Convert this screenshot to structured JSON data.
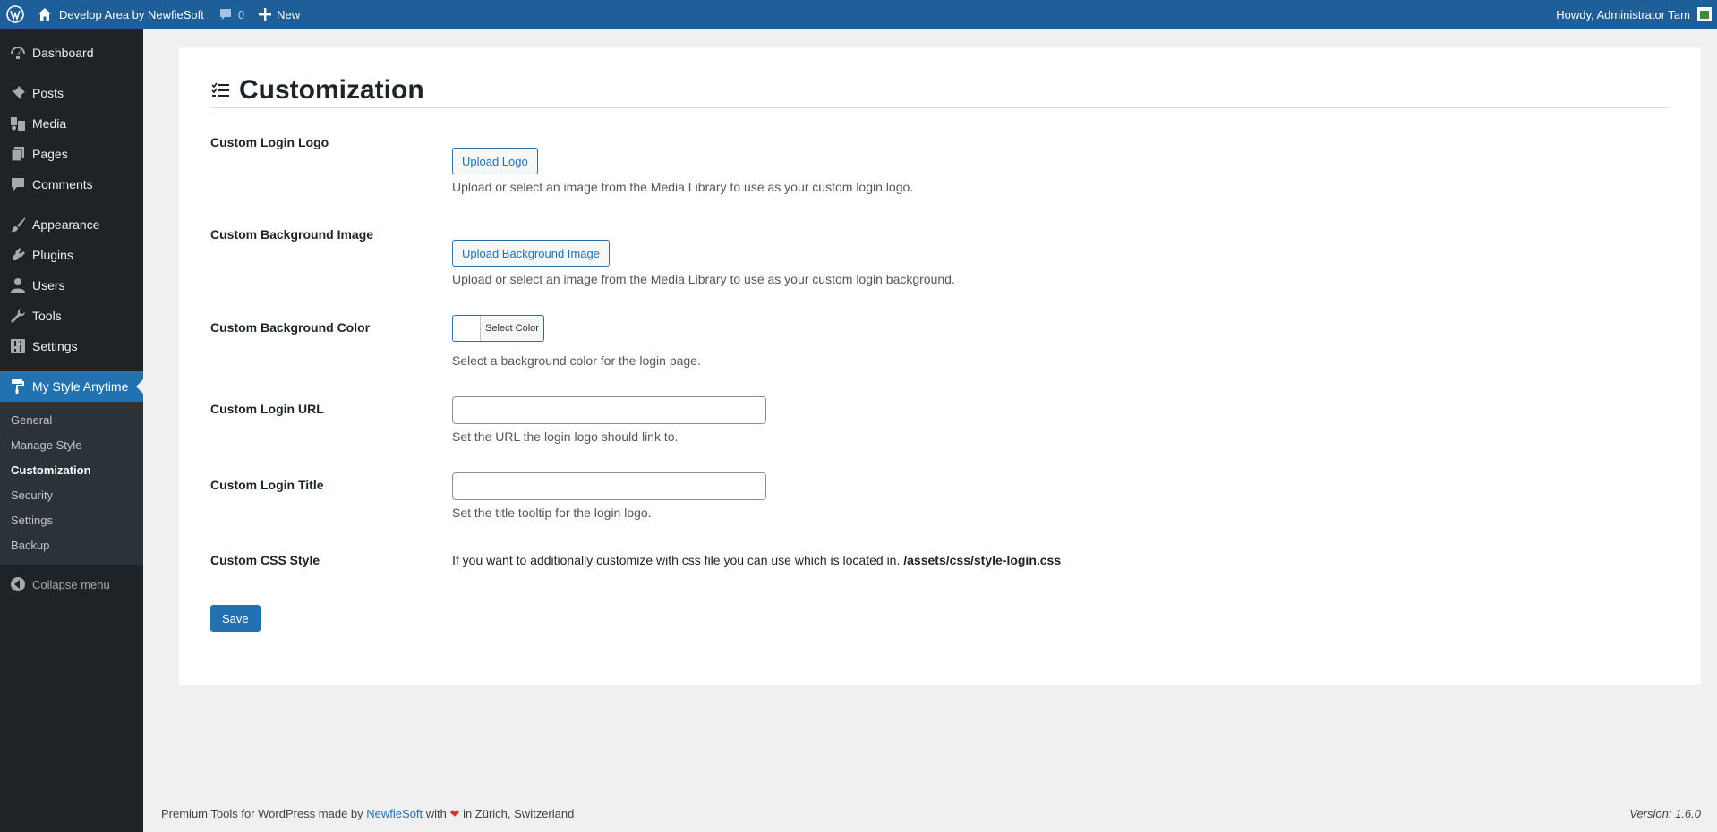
{
  "admin_bar": {
    "site_name": "Develop Area by NewfieSoft",
    "comments_count": "0",
    "new_label": "New",
    "greeting": "Howdy, Administrator Tam"
  },
  "sidebar": {
    "items": [
      {
        "label": "Dashboard",
        "icon": "dashboard-icon"
      },
      {
        "label": "Posts",
        "icon": "pin-icon"
      },
      {
        "label": "Media",
        "icon": "media-icon"
      },
      {
        "label": "Pages",
        "icon": "pages-icon"
      },
      {
        "label": "Comments",
        "icon": "comment-icon"
      },
      {
        "label": "Appearance",
        "icon": "brush-icon"
      },
      {
        "label": "Plugins",
        "icon": "plug-icon"
      },
      {
        "label": "Users",
        "icon": "user-icon"
      },
      {
        "label": "Tools",
        "icon": "wrench-icon"
      },
      {
        "label": "Settings",
        "icon": "settings-icon"
      },
      {
        "label": "My Style Anytime",
        "icon": "paint-roller-icon"
      }
    ],
    "submenu": [
      "General",
      "Manage Style",
      "Customization",
      "Security",
      "Settings",
      "Backup"
    ],
    "collapse_label": "Collapse menu"
  },
  "page": {
    "title": "Customization",
    "logo": {
      "label": "Custom Login Logo",
      "button": "Upload Logo",
      "description": "Upload or select an image from the Media Library to use as your custom login logo."
    },
    "background_image": {
      "label": "Custom Background Image",
      "button": "Upload Background Image",
      "description": "Upload or select an image from the Media Library to use as your custom login background."
    },
    "background_color": {
      "label": "Custom Background Color",
      "button": "Select Color",
      "description": "Select a background color for the login page."
    },
    "login_url": {
      "label": "Custom Login URL",
      "value": "",
      "description": "Set the URL the login logo should link to."
    },
    "login_title": {
      "label": "Custom Login Title",
      "value": "",
      "description": "Set the title tooltip for the login logo."
    },
    "css_style": {
      "label": "Custom CSS Style",
      "text": "If you want to additionally customize with css file you can use which is located in.",
      "path": "/assets/css/style-login.css"
    },
    "save_label": "Save"
  },
  "footer": {
    "prefix": "Premium Tools for WordPress made by",
    "link": "NewfieSoft",
    "with": "with",
    "suffix": "in Zürich, Switzerland",
    "version": "Version: 1.6.0"
  },
  "colors": {
    "admin_bar": "#1e5e99",
    "sidebar": "#1d2327",
    "accent": "#2271b1"
  }
}
